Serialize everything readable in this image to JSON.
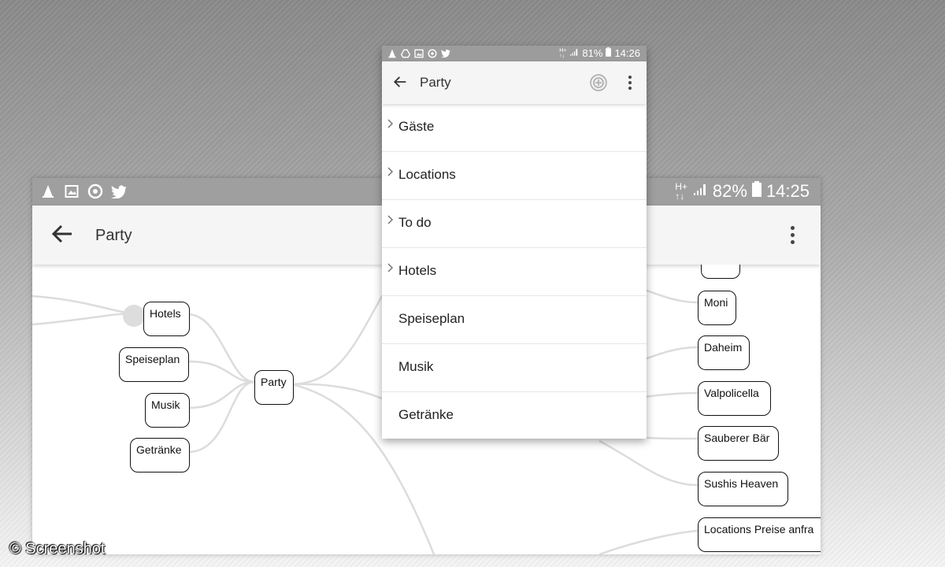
{
  "back_screen": {
    "status": {
      "battery": "82%",
      "time": "14:25"
    },
    "app_title": "Party",
    "mindmap": {
      "center": "Party",
      "left_nodes": [
        "Hotels",
        "Speiseplan",
        "Musik",
        "Getränke"
      ],
      "right_nodes": [
        "Moni",
        "Daheim",
        "Valpolicella",
        "Sauberer Bär",
        "Sushis Heaven",
        "Locations Preise anfra"
      ]
    }
  },
  "front_screen": {
    "status": {
      "battery": "81%",
      "time": "14:26"
    },
    "app_title": "Party",
    "items": [
      {
        "label": "Gäste",
        "expandable": true
      },
      {
        "label": "Locations",
        "expandable": true
      },
      {
        "label": "To do",
        "expandable": true
      },
      {
        "label": "Hotels",
        "expandable": true
      },
      {
        "label": "Speiseplan",
        "expandable": false
      },
      {
        "label": "Musik",
        "expandable": false
      },
      {
        "label": "Getränke",
        "expandable": false
      }
    ]
  },
  "watermark": "© Screenshot"
}
